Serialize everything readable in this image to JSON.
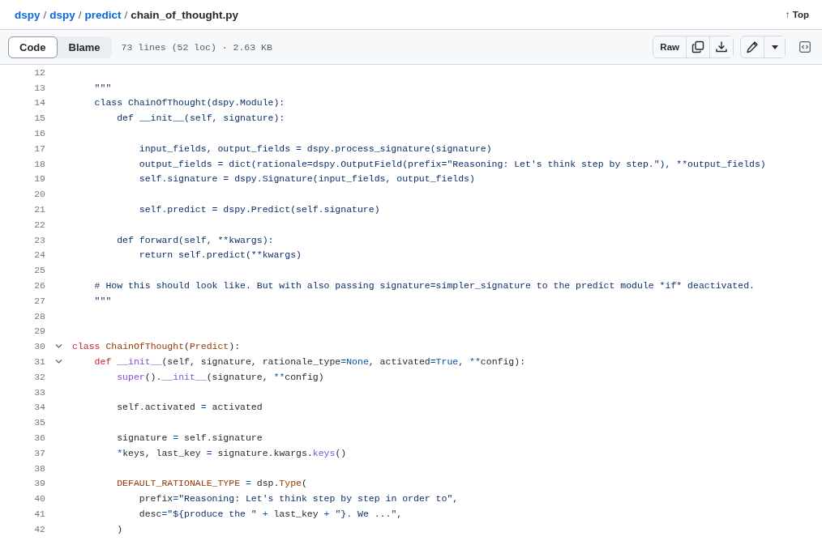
{
  "breadcrumb": {
    "links": [
      "dspy",
      "dspy",
      "predict"
    ],
    "separator": "/",
    "current": "chain_of_thought.py"
  },
  "top_link": {
    "arrow": "↑",
    "label": "Top"
  },
  "toolbar": {
    "tabs": [
      {
        "label": "Code",
        "selected": true
      },
      {
        "label": "Blame",
        "selected": false
      }
    ],
    "file_info": "73 lines (52 loc) · 2.63 KB",
    "raw_label": "Raw"
  },
  "code_lines": [
    {
      "number": "12"
    },
    {
      "number": "13",
      "tokens": [
        {
          "text": "    \"\"\"",
          "kind": "string"
        }
      ]
    },
    {
      "number": "14",
      "tokens": [
        {
          "text": "    class ChainOfThought(dspy.Module):",
          "kind": "string"
        }
      ]
    },
    {
      "number": "15",
      "tokens": [
        {
          "text": "        def __init__(self, signature):",
          "kind": "string"
        }
      ]
    },
    {
      "number": "16"
    },
    {
      "number": "17",
      "tokens": [
        {
          "text": "            input_fields, output_fields = dspy.process_signature(signature)",
          "kind": "string"
        }
      ]
    },
    {
      "number": "18",
      "tokens": [
        {
          "text": "            output_fields = dict(rationale=dspy.OutputField(prefix=\"Reasoning: Let's think step by step.\"), **output_fields)",
          "kind": "string"
        }
      ]
    },
    {
      "number": "19",
      "tokens": [
        {
          "text": "            self.signature = dspy.Signature(input_fields, output_fields)",
          "kind": "string"
        }
      ]
    },
    {
      "number": "20"
    },
    {
      "number": "21",
      "tokens": [
        {
          "text": "            self.predict = dspy.Predict(self.signature)",
          "kind": "string"
        }
      ]
    },
    {
      "number": "22"
    },
    {
      "number": "23",
      "tokens": [
        {
          "text": "        def forward(self, **kwargs):",
          "kind": "string"
        }
      ]
    },
    {
      "number": "24",
      "tokens": [
        {
          "text": "            return self.predict(**kwargs)",
          "kind": "string"
        }
      ]
    },
    {
      "number": "25"
    },
    {
      "number": "26",
      "tokens": [
        {
          "text": "    # How this should look like. But with also passing signature=simpler_signature to the predict module *if* deactivated.",
          "kind": "string"
        }
      ]
    },
    {
      "number": "27",
      "tokens": [
        {
          "text": "    \"\"\"",
          "kind": "string"
        }
      ]
    },
    {
      "number": "28"
    },
    {
      "number": "29"
    },
    {
      "number": "30",
      "expanded": true,
      "tokens": [
        {
          "text": "class ",
          "kind": "keyword"
        },
        {
          "text": "ChainOfThought",
          "kind": "entity"
        },
        {
          "text": "(",
          "kind": "plain"
        },
        {
          "text": "Predict",
          "kind": "entity"
        },
        {
          "text": "):",
          "kind": "plain"
        }
      ]
    },
    {
      "number": "31",
      "expanded": true,
      "tokens": [
        {
          "text": "    def ",
          "kind": "keyword"
        },
        {
          "text": "__init__",
          "kind": "function"
        },
        {
          "text": "(self, signature, rationale_type",
          "kind": "plain"
        },
        {
          "text": "=None",
          "kind": "constant"
        },
        {
          "text": ", activated",
          "kind": "plain"
        },
        {
          "text": "=True",
          "kind": "constant"
        },
        {
          "text": ", ",
          "kind": "plain"
        },
        {
          "text": "**",
          "kind": "constant"
        },
        {
          "text": "config):",
          "kind": "plain"
        }
      ]
    },
    {
      "number": "32",
      "tokens": [
        {
          "text": "        super",
          "kind": "function"
        },
        {
          "text": "().",
          "kind": "plain"
        },
        {
          "text": "__init__",
          "kind": "function"
        },
        {
          "text": "(signature, ",
          "kind": "plain"
        },
        {
          "text": "**",
          "kind": "constant"
        },
        {
          "text": "config)",
          "kind": "plain"
        }
      ]
    },
    {
      "number": "33"
    },
    {
      "number": "34",
      "tokens": [
        {
          "text": "        self.activated ",
          "kind": "plain"
        },
        {
          "text": "=",
          "kind": "constant"
        },
        {
          "text": " activated",
          "kind": "plain"
        }
      ]
    },
    {
      "number": "35"
    },
    {
      "number": "36",
      "tokens": [
        {
          "text": "        signature ",
          "kind": "plain"
        },
        {
          "text": "=",
          "kind": "constant"
        },
        {
          "text": " self.signature",
          "kind": "plain"
        }
      ]
    },
    {
      "number": "37",
      "tokens": [
        {
          "text": "        *",
          "kind": "constant"
        },
        {
          "text": "keys, last_key ",
          "kind": "plain"
        },
        {
          "text": "=",
          "kind": "constant"
        },
        {
          "text": " signature.kwargs.",
          "kind": "plain"
        },
        {
          "text": "keys",
          "kind": "function"
        },
        {
          "text": "()",
          "kind": "plain"
        }
      ]
    },
    {
      "number": "38"
    },
    {
      "number": "39",
      "tokens": [
        {
          "text": "        DEFAULT_RATIONALE_TYPE ",
          "kind": "entity"
        },
        {
          "text": "=",
          "kind": "constant"
        },
        {
          "text": " dsp.",
          "kind": "plain"
        },
        {
          "text": "Type",
          "kind": "entity"
        },
        {
          "text": "(",
          "kind": "plain"
        }
      ]
    },
    {
      "number": "40",
      "tokens": [
        {
          "text": "            prefix",
          "kind": "plain"
        },
        {
          "text": "=",
          "kind": "constant"
        },
        {
          "text": "\"Reasoning: Let's think step by step in order to\"",
          "kind": "string"
        },
        {
          "text": ",",
          "kind": "plain"
        }
      ]
    },
    {
      "number": "41",
      "tokens": [
        {
          "text": "            desc",
          "kind": "plain"
        },
        {
          "text": "=",
          "kind": "constant"
        },
        {
          "text": "\"${produce the \"",
          "kind": "string"
        },
        {
          "text": " +",
          "kind": "constant"
        },
        {
          "text": " last_key ",
          "kind": "plain"
        },
        {
          "text": "+ ",
          "kind": "constant"
        },
        {
          "text": "\"}. We ...\"",
          "kind": "string"
        },
        {
          "text": ",",
          "kind": "plain"
        }
      ]
    },
    {
      "number": "42",
      "tokens": [
        {
          "text": "        )",
          "kind": "plain"
        }
      ]
    }
  ]
}
